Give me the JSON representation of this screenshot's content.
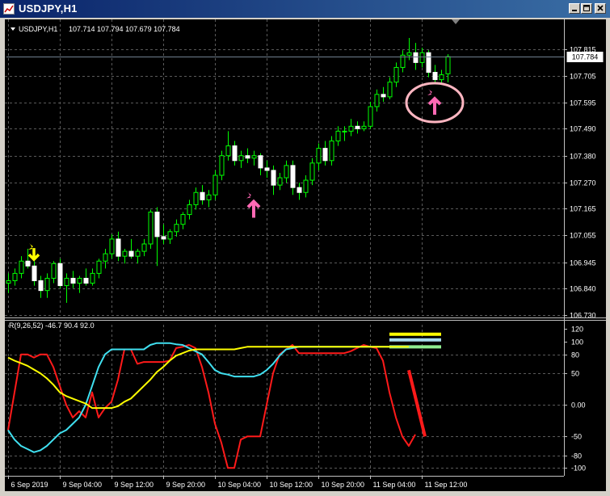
{
  "window": {
    "title": "USDJPY,H1",
    "buttons": [
      "minimize",
      "maximize",
      "close"
    ]
  },
  "colors": {
    "background": "#000000",
    "grid": "#5a5a5a",
    "candle_up": "#00ff00",
    "candle_down": "#ffffff",
    "red_line": "#ff1a1a",
    "cyan_line": "#40e0f0",
    "yellow_line": "#ffff00",
    "pink_arrow": "#ff69b4",
    "yellow_arrow": "#ffff00",
    "price_line": "#708090"
  },
  "chart_data": [
    {
      "type": "candlestick",
      "symbol_header": "USDJPY,H1",
      "ohlc_header": "107.714 107.794 107.679 107.784",
      "current_price_label": "107.784",
      "current_price": 107.784,
      "ylim": [
        106.73,
        107.87
      ],
      "y_ticks": [
        "107.815",
        "107.705",
        "107.595",
        "107.490",
        "107.380",
        "107.270",
        "107.165",
        "107.055",
        "106.945",
        "106.840",
        "106.730"
      ],
      "y_tick_values": [
        107.815,
        107.705,
        107.595,
        107.49,
        107.38,
        107.27,
        107.165,
        107.055,
        106.945,
        106.84,
        106.73
      ],
      "x_ticks": [
        "6 Sep 2019",
        "9 Sep 04:00",
        "9 Sep 12:00",
        "9 Sep 20:00",
        "10 Sep 04:00",
        "10 Sep 12:00",
        "10 Sep 20:00",
        "11 Sep 04:00",
        "11 Sep 12:00"
      ],
      "x_tick_index": [
        0,
        8,
        16,
        24,
        32,
        40,
        48,
        56,
        64
      ],
      "grid": true,
      "series": [
        {
          "candles": [
            [
              106.86,
              106.9,
              106.82,
              106.87
            ],
            [
              106.87,
              106.92,
              106.85,
              106.9
            ],
            [
              106.9,
              106.97,
              106.88,
              106.95
            ],
            [
              106.95,
              107.0,
              106.92,
              106.93
            ],
            [
              106.93,
              106.95,
              106.85,
              106.87
            ],
            [
              106.87,
              106.89,
              106.8,
              106.83
            ],
            [
              106.83,
              106.9,
              106.8,
              106.88
            ],
            [
              106.88,
              106.95,
              106.86,
              106.94
            ],
            [
              106.94,
              106.96,
              106.84,
              106.85
            ],
            [
              106.85,
              106.9,
              106.78,
              106.88
            ],
            [
              106.88,
              106.91,
              106.84,
              106.86
            ],
            [
              106.86,
              106.89,
              106.82,
              106.88
            ],
            [
              106.88,
              106.92,
              106.85,
              106.86
            ],
            [
              106.86,
              106.92,
              106.85,
              106.9
            ],
            [
              106.9,
              106.96,
              106.88,
              106.95
            ],
            [
              106.95,
              107.0,
              106.92,
              106.98
            ],
            [
              106.98,
              107.06,
              106.96,
              107.04
            ],
            [
              107.04,
              107.07,
              106.95,
              106.97
            ],
            [
              106.97,
              107.0,
              106.94,
              106.99
            ],
            [
              106.99,
              107.04,
              106.96,
              106.97
            ],
            [
              106.97,
              107.0,
              106.94,
              106.99
            ],
            [
              106.99,
              107.04,
              106.97,
              107.02
            ],
            [
              107.02,
              107.16,
              107.0,
              107.15
            ],
            [
              107.15,
              107.17,
              106.93,
              107.05
            ],
            [
              107.05,
              107.1,
              107.02,
              107.04
            ],
            [
              107.04,
              107.08,
              107.02,
              107.07
            ],
            [
              107.07,
              107.12,
              107.05,
              107.1
            ],
            [
              107.1,
              107.15,
              107.08,
              107.14
            ],
            [
              107.14,
              107.2,
              107.12,
              107.18
            ],
            [
              107.18,
              107.25,
              107.16,
              107.23
            ],
            [
              107.23,
              107.26,
              107.18,
              107.2
            ],
            [
              107.2,
              107.24,
              107.17,
              107.22
            ],
            [
              107.22,
              107.32,
              107.2,
              107.3
            ],
            [
              107.3,
              107.4,
              107.28,
              107.38
            ],
            [
              107.38,
              107.48,
              107.36,
              107.42
            ],
            [
              107.42,
              107.44,
              107.34,
              107.36
            ],
            [
              107.36,
              107.4,
              107.33,
              107.38
            ],
            [
              107.38,
              107.41,
              107.35,
              107.37
            ],
            [
              107.37,
              107.4,
              107.34,
              107.38
            ],
            [
              107.38,
              107.39,
              107.3,
              107.33
            ],
            [
              107.33,
              107.36,
              107.29,
              107.32
            ],
            [
              107.32,
              107.34,
              107.22,
              107.26
            ],
            [
              107.26,
              107.31,
              107.24,
              107.29
            ],
            [
              107.29,
              107.36,
              107.27,
              107.34
            ],
            [
              107.34,
              107.36,
              107.22,
              107.25
            ],
            [
              107.25,
              107.27,
              107.2,
              107.23
            ],
            [
              107.23,
              107.3,
              107.21,
              107.28
            ],
            [
              107.28,
              107.37,
              107.26,
              107.35
            ],
            [
              107.35,
              107.43,
              107.32,
              107.41
            ],
            [
              107.41,
              107.44,
              107.34,
              107.36
            ],
            [
              107.36,
              107.46,
              107.34,
              107.44
            ],
            [
              107.44,
              107.5,
              107.42,
              107.48
            ],
            [
              107.48,
              107.5,
              107.44,
              107.48
            ],
            [
              107.48,
              107.53,
              107.46,
              107.5
            ],
            [
              107.5,
              107.52,
              107.47,
              107.49
            ],
            [
              107.49,
              107.52,
              107.48,
              107.5
            ],
            [
              107.5,
              107.6,
              107.49,
              107.58
            ],
            [
              107.58,
              107.65,
              107.56,
              107.63
            ],
            [
              107.63,
              107.66,
              107.6,
              107.62
            ],
            [
              107.62,
              107.7,
              107.61,
              107.68
            ],
            [
              107.68,
              107.76,
              107.66,
              107.74
            ],
            [
              107.74,
              107.81,
              107.72,
              107.79
            ],
            [
              107.79,
              107.86,
              107.77,
              107.8
            ],
            [
              107.8,
              107.84,
              107.73,
              107.76
            ],
            [
              107.76,
              107.82,
              107.74,
              107.8
            ],
            [
              107.8,
              107.81,
              107.7,
              107.72
            ],
            [
              107.72,
              107.75,
              107.68,
              107.69
            ],
            [
              107.69,
              107.73,
              107.67,
              107.71
            ],
            [
              107.714,
              107.794,
              107.679,
              107.784
            ]
          ]
        }
      ],
      "markers": [
        {
          "kind": "down-arrow",
          "color": "yellow",
          "index": 4,
          "price": 106.99
        },
        {
          "kind": "up-arrow",
          "color": "pink",
          "index": 38,
          "price": 107.16
        },
        {
          "kind": "up-arrow",
          "color": "pink",
          "index": 66,
          "price": 107.58
        }
      ]
    },
    {
      "type": "line",
      "indicator_header": "R(9,26,52) -46.7 90.4 92.0",
      "ylim": [
        -106,
        127
      ],
      "y_ticks": [
        "120",
        "100",
        "80",
        "50",
        "0.00",
        "-50",
        "-80",
        "-100"
      ],
      "y_tick_values": [
        120,
        100,
        80,
        50,
        0,
        -50,
        -80,
        -100
      ],
      "series": [
        {
          "name": "",
          "color": "red",
          "values": [
            -40,
            20,
            80,
            80,
            75,
            80,
            80,
            60,
            30,
            0,
            -20,
            -10,
            -20,
            20,
            -20,
            -5,
            5,
            40,
            88,
            88,
            65,
            68,
            68,
            68,
            68,
            70,
            90,
            92,
            95,
            90,
            60,
            20,
            -30,
            -60,
            -100,
            -100,
            -55,
            -50,
            -50,
            -50,
            0,
            50,
            80,
            88,
            95,
            82,
            82,
            82,
            82,
            82,
            82,
            82,
            82,
            85,
            90,
            95,
            92,
            90,
            70,
            20,
            -20,
            -50,
            -65,
            -47
          ]
        },
        {
          "name": "",
          "color": "cyan",
          "values": [
            -40,
            -55,
            -65,
            -70,
            -75,
            -72,
            -65,
            -55,
            -45,
            -40,
            -30,
            -20,
            0,
            30,
            60,
            80,
            88,
            88,
            88,
            88,
            88,
            88,
            95,
            98,
            98,
            98,
            96,
            95,
            90,
            85,
            80,
            68,
            55,
            50,
            48,
            45,
            45,
            45,
            45,
            48,
            55,
            65,
            78,
            88,
            90,
            92,
            92,
            92,
            92,
            92,
            92,
            92,
            92,
            92,
            92,
            92,
            92,
            92,
            92,
            92,
            92,
            92,
            92
          ]
        },
        {
          "name": "",
          "color": "yellow",
          "values": [
            75,
            70,
            66,
            62,
            56,
            50,
            42,
            32,
            20,
            14,
            10,
            6,
            2,
            -5,
            -5,
            -5,
            -5,
            -2,
            5,
            10,
            20,
            30,
            40,
            52,
            60,
            70,
            78,
            82,
            86,
            88,
            88,
            88,
            88,
            88,
            88,
            88,
            90,
            92,
            92,
            92,
            92,
            92,
            92,
            92,
            92,
            92,
            92,
            92,
            92,
            92,
            92,
            92,
            92,
            92,
            92,
            92,
            92,
            92,
            92,
            92,
            92,
            92,
            92
          ]
        }
      ],
      "annotations": [
        {
          "kind": "horizontal-bar",
          "color": "yellow",
          "value": 112
        },
        {
          "kind": "horizontal-bar",
          "color": "lightblue",
          "value": 103
        },
        {
          "kind": "horizontal-bar",
          "color": "lightgreen",
          "value": 92
        },
        {
          "kind": "thick-down-stroke",
          "color": "red",
          "from": 55,
          "to": -50
        }
      ]
    }
  ]
}
